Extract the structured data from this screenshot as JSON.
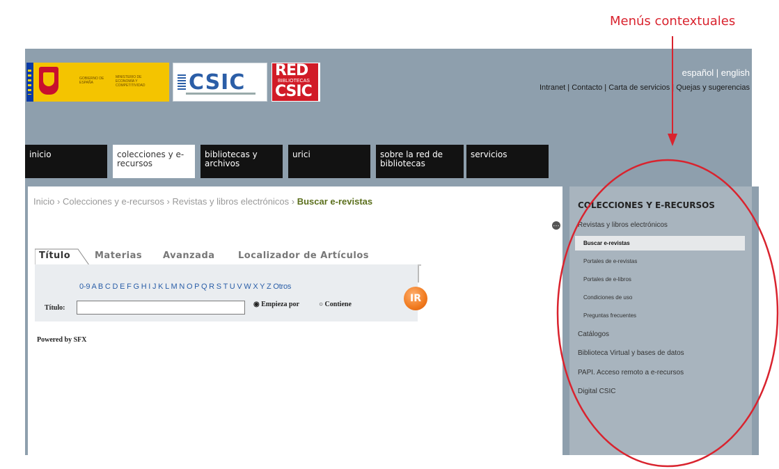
{
  "annotation": {
    "title": "Menús contextuales",
    "color": "#d9232e"
  },
  "header": {
    "logos": {
      "gov": "GOBIERNO DE ESPAÑA",
      "ministry": "MINISTERIO DE ECONOMÍA Y COMPETITIVIDAD",
      "csic": "CSIC",
      "red_top": "RED",
      "red_mid": "BIBLIOTECAS",
      "red_bottom": "CSIC"
    },
    "lang": "español | english",
    "links": "Intranet | Contacto | Carta de servicios | Quejas y sugerencias"
  },
  "nav": {
    "tabs": [
      {
        "label": "inicio"
      },
      {
        "label": "colecciones y e-recursos"
      },
      {
        "label": "bibliotecas y archivos"
      },
      {
        "label": "urici"
      },
      {
        "label": "sobre la red de bibliotecas"
      },
      {
        "label": "servicios"
      }
    ],
    "active_index": 1
  },
  "breadcrumb": {
    "items": [
      "Inicio",
      "Colecciones y e-recursos",
      "Revistas y libros electrónicos"
    ],
    "separator": "›",
    "current": "Buscar e-revistas"
  },
  "sfx": {
    "tabs": [
      "Título",
      "Materias",
      "Avanzada",
      "Localizador de Artículos"
    ],
    "alphabet": "0-9 A B C D E F G H I J K L M N O P Q R S T U V W X Y Z Otros",
    "title_label": "Título:",
    "title_value": "",
    "radio_starts": "Empieza por",
    "radio_contains": "Contiene",
    "go_button": "IR",
    "powered": "Powered by SFX"
  },
  "sidebar": {
    "title": "COLECCIONES Y E-RECURSOS",
    "items": [
      {
        "label": "Revistas y libros electrónicos",
        "level": 1
      },
      {
        "label": "Buscar e-revistas",
        "level": 2,
        "active": true
      },
      {
        "label": "Portales de e-revistas",
        "level": 2
      },
      {
        "label": "Portales de e-libros",
        "level": 2
      },
      {
        "label": "Condiciones de uso",
        "level": 2
      },
      {
        "label": "Preguntas frecuentes",
        "level": 2
      },
      {
        "label": "Catálogos",
        "level": 1
      },
      {
        "label": "Biblioteca Virtual y bases de datos",
        "level": 1
      },
      {
        "label": "PAPI. Acceso remoto a e-recursos",
        "level": 1
      },
      {
        "label": "Digital CSIC",
        "level": 1
      }
    ]
  },
  "colors": {
    "site_bg": "#8e9fad",
    "nav_bg": "#121212",
    "sidebar_bg": "#a8b4be",
    "accent_orange": "#f07a1e",
    "link_blue": "#2a5ea8"
  },
  "icons": [
    "options-icon",
    "go-arrow-icon"
  ]
}
